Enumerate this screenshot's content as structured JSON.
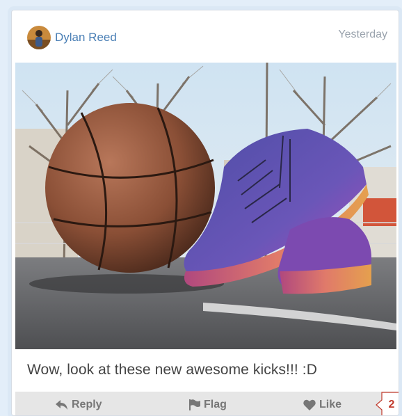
{
  "post": {
    "author": "Dylan Reed",
    "timestamp": "Yesterday",
    "caption": "Wow, look at these new awesome kicks!!! :D",
    "image_alt": "Basketball and sneakers on a court"
  },
  "actions": {
    "reply_label": "Reply",
    "flag_label": "Flag",
    "like_label": "Like",
    "like_count": "2"
  },
  "icons": {
    "reply": "reply-arrow-icon",
    "flag": "flag-icon",
    "like": "heart-icon"
  },
  "colors": {
    "author_link": "#4a7fb5",
    "timestamp": "#9aa3ad",
    "action_text": "#777777",
    "badge": "#c0392b",
    "page_bg": "#e3eef9"
  }
}
